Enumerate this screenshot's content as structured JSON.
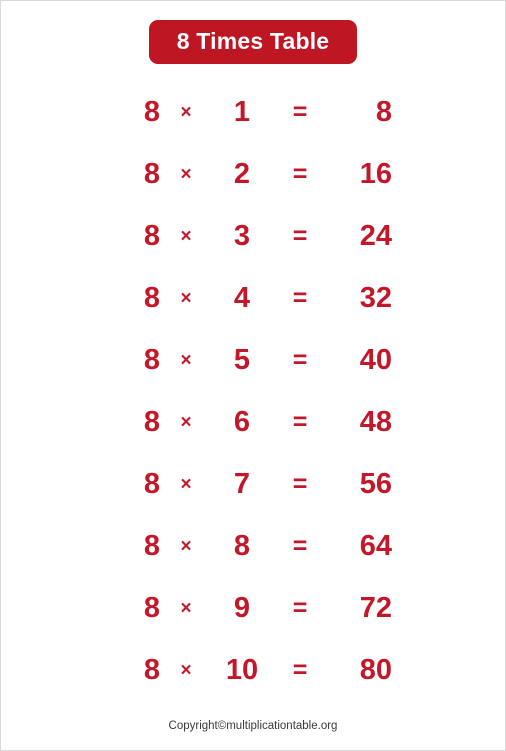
{
  "page": {
    "border_color": "#d9d9d9",
    "background": "#ffffff"
  },
  "header": {
    "title": "8 Times Table",
    "badge_color": "#BE1622",
    "text_color": "#ffffff"
  },
  "table": {
    "text_color": "#C2182A",
    "times_symbol": "×",
    "equals_symbol": "=",
    "rows": [
      {
        "operand": "8",
        "times": "×",
        "multiplier": "1",
        "equals": "=",
        "result": "8"
      },
      {
        "operand": "8",
        "times": "×",
        "multiplier": "2",
        "equals": "=",
        "result": "16"
      },
      {
        "operand": "8",
        "times": "×",
        "multiplier": "3",
        "equals": "=",
        "result": "24"
      },
      {
        "operand": "8",
        "times": "×",
        "multiplier": "4",
        "equals": "=",
        "result": "32"
      },
      {
        "operand": "8",
        "times": "×",
        "multiplier": "5",
        "equals": "=",
        "result": "40"
      },
      {
        "operand": "8",
        "times": "×",
        "multiplier": "6",
        "equals": "=",
        "result": "48"
      },
      {
        "operand": "8",
        "times": "×",
        "multiplier": "7",
        "equals": "=",
        "result": "56"
      },
      {
        "operand": "8",
        "times": "×",
        "multiplier": "8",
        "equals": "=",
        "result": "64"
      },
      {
        "operand": "8",
        "times": "×",
        "multiplier": "9",
        "equals": "=",
        "result": "72"
      },
      {
        "operand": "8",
        "times": "×",
        "multiplier": "10",
        "equals": "=",
        "result": "80"
      }
    ]
  },
  "footer": {
    "copyright": "Copyright©multiplicationtable.org",
    "text_color": "#3a3a3a"
  }
}
